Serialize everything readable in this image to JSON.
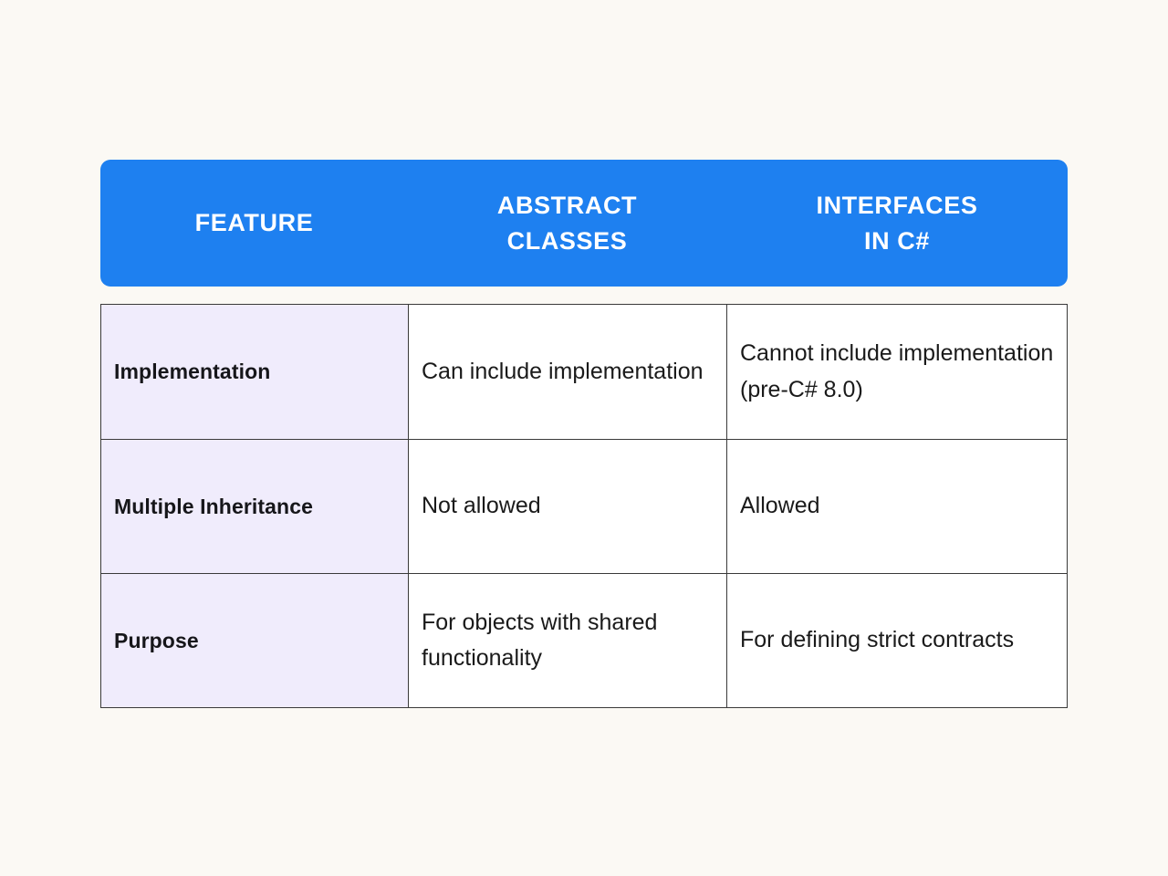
{
  "page": {
    "background_color": "#FBF9F4",
    "accent_color": "#1E80F0",
    "label_cell_color": "#F0ECFC",
    "body_cell_color": "#FFFFFF",
    "border_color": "#3A3A3A"
  },
  "table": {
    "header": {
      "columns": [
        {
          "label": "FEATURE"
        },
        {
          "label": "ABSTRACT\nCLASSES"
        },
        {
          "label": "INTERFACES\nIN C#"
        }
      ]
    },
    "rows": [
      {
        "feature": "Implementation",
        "abstract_classes": "Can include implementation",
        "interfaces": "Cannot include implementation (pre-C# 8.0)"
      },
      {
        "feature": "Multiple Inheritance",
        "abstract_classes": "Not allowed",
        "interfaces": "Allowed"
      },
      {
        "feature": "Purpose",
        "abstract_classes": "For objects with shared functionality",
        "interfaces": "For defining strict contracts"
      }
    ]
  }
}
